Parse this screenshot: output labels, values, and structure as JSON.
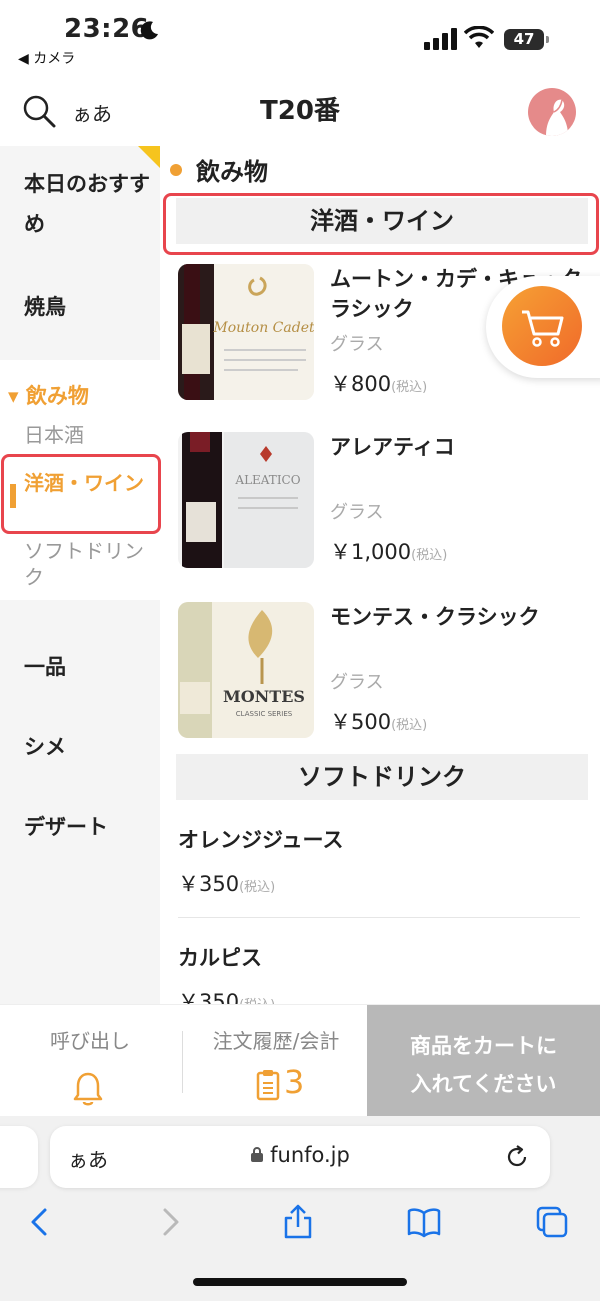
{
  "status": {
    "time": "23:26",
    "back_app": "◀ カメラ",
    "battery": "47"
  },
  "header": {
    "text_size": "ぁあ",
    "title": "T20番"
  },
  "sidebar": {
    "items": [
      "本日のおすすめ",
      "焼鳥"
    ],
    "group_label": "▾ 飲み物",
    "sub_items": [
      "日本酒",
      "洋酒・ワイン",
      "ソフトドリンク"
    ],
    "items_after": [
      "一品",
      "シメ",
      "デザート"
    ]
  },
  "content": {
    "category": "飲み物",
    "sections": [
      {
        "title": "洋酒・ワイン",
        "products": [
          {
            "name": "ムートン・カデ・キュ・クラシック",
            "size": "グラス",
            "price": "￥800",
            "tax": "(税込)"
          },
          {
            "name": "アレアティコ",
            "size": "グラス",
            "price": "￥1,000",
            "tax": "(税込)"
          },
          {
            "name": "モンテス・クラシック",
            "size": "グラス",
            "price": "￥500",
            "tax": "(税込)"
          }
        ]
      },
      {
        "title": "ソフトドリンク",
        "products": [
          {
            "name": "オレンジジュース",
            "price": "￥350",
            "tax": "(税込)"
          },
          {
            "name": "カルピス",
            "price": "￥350",
            "tax": "(税込)"
          }
        ]
      }
    ],
    "label_texts": {
      "mouton": "Mouton Cadet",
      "aleatico": "ALEATICO",
      "montes": "MONTES",
      "montes_sub": "CLASSIC SERIES"
    }
  },
  "action_bar": {
    "call": "呼び出し",
    "history": "注文履歴/会計",
    "history_count": "3",
    "cart_line1": "商品をカートに",
    "cart_line2": "入れてください"
  },
  "safari": {
    "text_size": "ぁあ",
    "host": "funfo.jp"
  },
  "colors": {
    "accent": "#f0a034",
    "highlight_box": "#e8454d",
    "cart_gradient": [
      "#f6a134",
      "#f06a2a"
    ]
  }
}
